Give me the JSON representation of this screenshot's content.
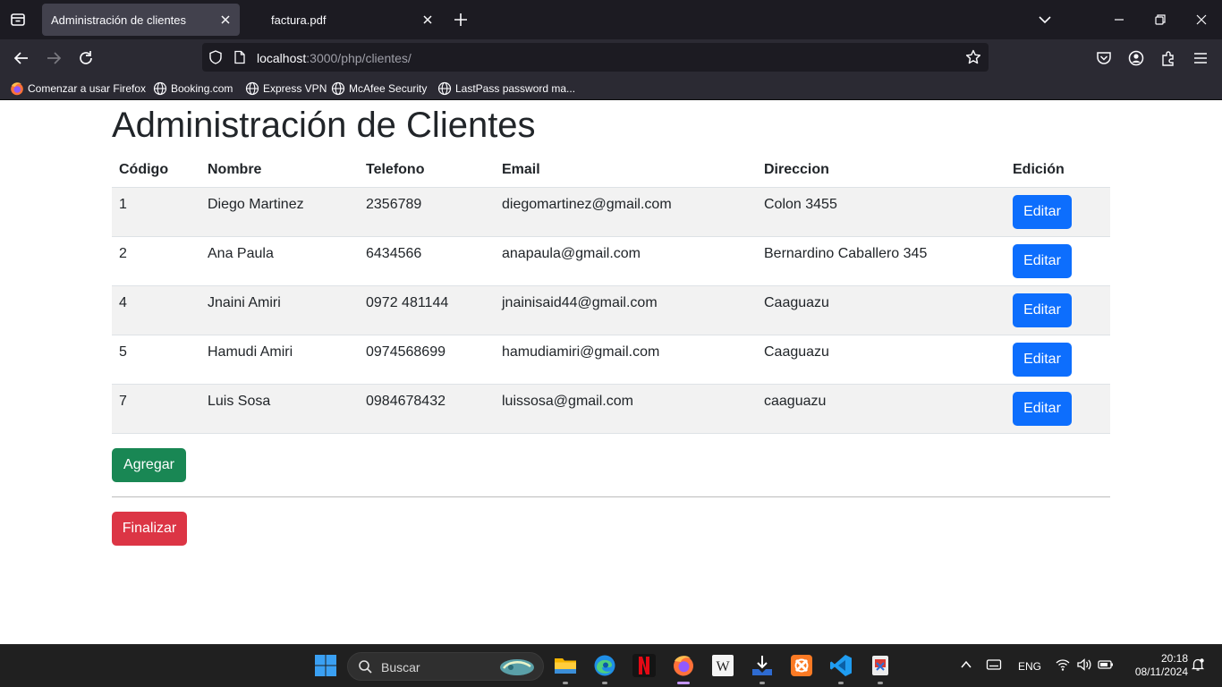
{
  "browser": {
    "tabs": [
      {
        "title": "Administración de clientes",
        "active": true
      },
      {
        "title": "factura.pdf",
        "active": false
      }
    ],
    "url": {
      "host": "localhost",
      "path": ":3000/php/clientes/"
    },
    "bookmarks": [
      {
        "label": "Comenzar a usar Firefox",
        "icon": "firefox-icon"
      },
      {
        "label": "Booking.com",
        "icon": "globe-icon"
      },
      {
        "label": "Express VPN",
        "icon": "globe-icon"
      },
      {
        "label": "McAfee Security",
        "icon": "globe-icon"
      },
      {
        "label": "LastPass password ma...",
        "icon": "globe-icon"
      }
    ]
  },
  "page": {
    "title": "Administración de Clientes",
    "table": {
      "headers": [
        "Código",
        "Nombre",
        "Telefono",
        "Email",
        "Direccion",
        "Edición"
      ],
      "rows": [
        {
          "codigo": "1",
          "nombre": "Diego Martinez",
          "telefono": "2356789",
          "email": "diegomartinez@gmail.com",
          "direccion": "Colon 3455"
        },
        {
          "codigo": "2",
          "nombre": "Ana Paula",
          "telefono": "6434566",
          "email": "anapaula@gmail.com",
          "direccion": "Bernardino Caballero 345"
        },
        {
          "codigo": "4",
          "nombre": "Jnaini Amiri",
          "telefono": "0972 481144",
          "email": "jnainisaid44@gmail.com",
          "direccion": "Caaguazu"
        },
        {
          "codigo": "5",
          "nombre": "Hamudi Amiri",
          "telefono": "0974568699",
          "email": "hamudiamiri@gmail.com",
          "direccion": "Caaguazu"
        },
        {
          "codigo": "7",
          "nombre": "Luis Sosa",
          "telefono": "0984678432",
          "email": "luissosa@gmail.com",
          "direccion": "caaguazu"
        }
      ],
      "edit_label": "Editar"
    },
    "add_label": "Agregar",
    "finish_label": "Finalizar",
    "colors": {
      "edit": "#0d6efd",
      "add": "#198754",
      "finish": "#dc3545"
    }
  },
  "taskbar": {
    "search_placeholder": "Buscar",
    "language": "ENG",
    "time": "20:18",
    "date": "08/11/2024",
    "apps": [
      "windows-start-icon",
      "file-explorer-icon",
      "edge-icon",
      "netflix-icon",
      "firefox-icon",
      "wikipedia-icon",
      "downloads-icon",
      "xampp-icon",
      "vscode-icon",
      "snipping-tool-icon"
    ]
  }
}
